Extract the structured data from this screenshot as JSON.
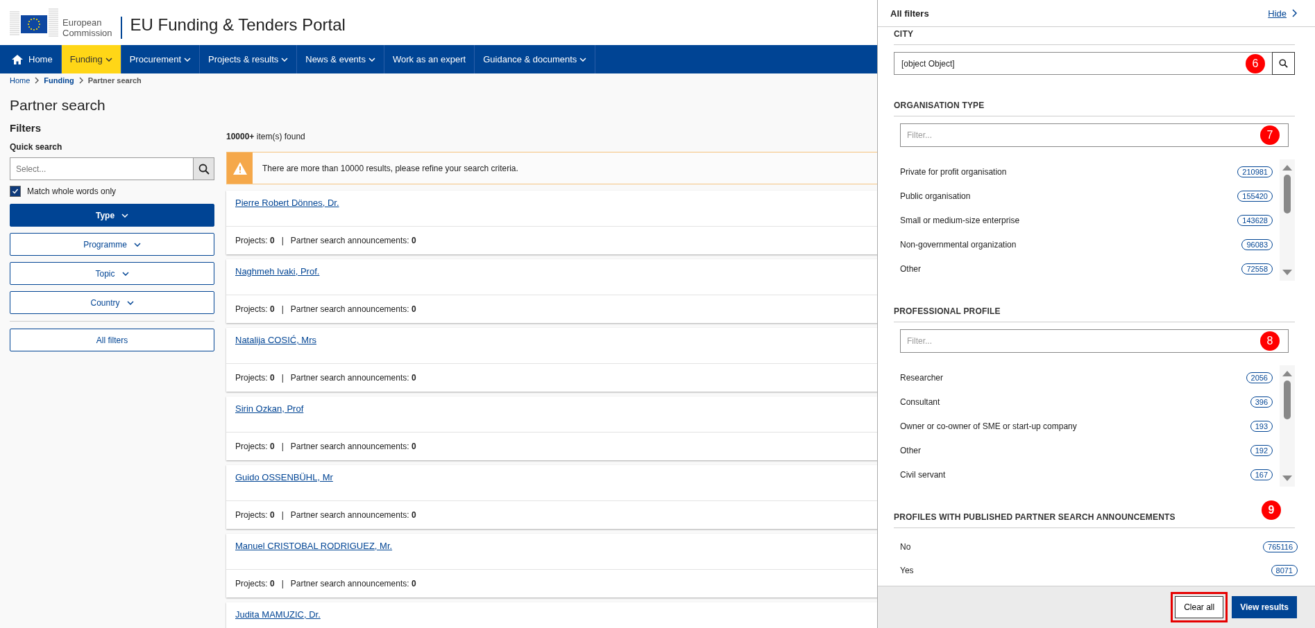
{
  "header": {
    "org_line1": "European",
    "org_line2": "Commission",
    "portal_title": "EU Funding & Tenders Portal"
  },
  "nav": [
    {
      "label": "Home",
      "kind": "home",
      "selected": false,
      "dropdown": false
    },
    {
      "label": "Funding",
      "kind": "menu",
      "selected": true,
      "dropdown": true
    },
    {
      "label": "Procurement",
      "kind": "menu",
      "selected": false,
      "dropdown": true
    },
    {
      "label": "Projects & results",
      "kind": "menu",
      "selected": false,
      "dropdown": true
    },
    {
      "label": "News & events",
      "kind": "menu",
      "selected": false,
      "dropdown": true
    },
    {
      "label": "Work as an expert",
      "kind": "menu",
      "selected": false,
      "dropdown": false
    },
    {
      "label": "Guidance & documents",
      "kind": "menu",
      "selected": false,
      "dropdown": true
    }
  ],
  "breadcrumb": [
    {
      "label": "Home"
    },
    {
      "label": "Funding"
    },
    {
      "label": "Partner search"
    }
  ],
  "page_title": "Partner search",
  "filters": {
    "title": "Filters",
    "quick_search_label": "Quick search",
    "quick_search_placeholder": "Select...",
    "match_whole_words": {
      "label": "Match whole words only",
      "checked": true
    },
    "buttons": [
      {
        "label": "Type",
        "selected": true
      },
      {
        "label": "Programme",
        "selected": false
      },
      {
        "label": "Topic",
        "selected": false
      },
      {
        "label": "Country",
        "selected": false
      }
    ],
    "all_filters": "All filters"
  },
  "results": {
    "count": "10000+",
    "count_suffix": "item(s) found",
    "warning": "There are more than 10000 results, please refine your search criteria.",
    "items": [
      {
        "name": "Pierre Robert Dönnes, Dr.",
        "footer": "Projects: **0**   |   Partner search announcements: **0**"
      },
      {
        "name": "Naghmeh Ivaki, Prof.",
        "footer": "Projects: **0**   |   Partner search announcements: **0**"
      },
      {
        "name": "Natalija COSIĆ, Mrs",
        "footer": "Projects: **0**   |   Partner search announcements: **0**"
      },
      {
        "name": "Sirin Ozkan, Prof",
        "footer": "Projects: **0**   |   Partner search announcements: **0**"
      },
      {
        "name": "Guido OSSENBÜHL, Mr",
        "footer": "Projects: **0**   |   Partner search announcements: **0**"
      },
      {
        "name": "Manuel CRISTOBAL RODRIGUEZ, Mr.",
        "footer": "Projects: **0**   |   Partner search announcements: **0**"
      },
      {
        "name": "Judita MAMUZIC, Dr."
      }
    ]
  },
  "panel": {
    "title": "All filters",
    "hide_link": "Hide",
    "sections": [
      {
        "kind": "search",
        "heading": "CITY",
        "value": "[object Object]",
        "marker": "6"
      },
      {
        "kind": "list",
        "heading": "ORGANISATION TYPE",
        "placeholder": "Filter...",
        "marker": "7",
        "items": [
          {
            "label": "Private for profit organisation",
            "count": "210981"
          },
          {
            "label": "Public organisation",
            "count": "155420"
          },
          {
            "label": "Small or medium-size enterprise",
            "count": "143628"
          },
          {
            "label": "Non-governmental organization",
            "count": "96083"
          },
          {
            "label": "Other",
            "count": "72558"
          }
        ]
      },
      {
        "kind": "list",
        "heading": "PROFESSIONAL PROFILE",
        "placeholder": "Filter...",
        "marker": "8",
        "items": [
          {
            "label": "Researcher",
            "count": "2056"
          },
          {
            "label": "Consultant",
            "count": "396"
          },
          {
            "label": "Owner or co-owner of SME or start-up company",
            "count": "193"
          },
          {
            "label": "Other",
            "count": "192"
          },
          {
            "label": "Civil servant",
            "count": "167"
          }
        ]
      },
      {
        "kind": "plain",
        "heading": "PROFILES WITH PUBLISHED PARTNER SEARCH ANNOUNCEMENTS",
        "marker": "9",
        "items": [
          {
            "label": "No",
            "count": "765116"
          },
          {
            "label": "Yes",
            "count": "8071"
          }
        ]
      }
    ],
    "clear_button": {
      "label": "Clear all",
      "highlighted": true
    },
    "view_button": "View results"
  }
}
